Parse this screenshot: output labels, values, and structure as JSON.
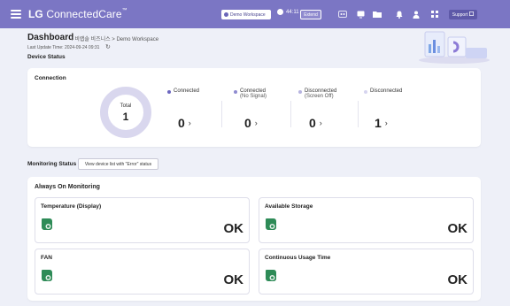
{
  "topbar": {
    "brand_main": "LG",
    "brand_sub": "ConnectedCare",
    "brand_tm": "™",
    "workspace_label": "Demo Workspace",
    "timer": "44:11",
    "extend_label": "Extend",
    "support_label": "Support",
    "colors": {
      "bar": "#7b76c4",
      "button_dark": "#5e59a8"
    }
  },
  "header": {
    "title": "Dashboard",
    "breadcrumb": "/ 비랩솔 비즈니스 > Demo Workspace",
    "last_update": "Last Update Time: 2024-09-24 09:31"
  },
  "device_status": {
    "section_label": "Device Status",
    "connection": {
      "title": "Connection",
      "total_label": "Total",
      "total_value": "1",
      "stats": [
        {
          "label": "Connected",
          "sub": "",
          "value": "0",
          "dot_color": "#6c67c0"
        },
        {
          "label": "Connected",
          "sub": "(No Signal)",
          "value": "0",
          "dot_color": "#8f8bd0"
        },
        {
          "label": "Disconnected",
          "sub": "(Screen Off)",
          "value": "0",
          "dot_color": "#b7b4e0"
        },
        {
          "label": "Disconnected",
          "sub": "",
          "value": "1",
          "dot_color": "#d6d4ef"
        }
      ],
      "donut_color": "#d9d7ee"
    }
  },
  "monitoring": {
    "section_label": "Monitoring Status",
    "error_button": "View device list with \"Error\" status",
    "always_on": {
      "title": "Always On Monitoring",
      "tiles": [
        {
          "title": "Temperature (Display)",
          "status": "OK"
        },
        {
          "title": "Available Storage",
          "status": "OK"
        },
        {
          "title": "FAN",
          "status": "OK"
        },
        {
          "title": "Continuous Usage Time",
          "status": "OK"
        }
      ],
      "ok_icon_color": "#2e8b57"
    }
  }
}
